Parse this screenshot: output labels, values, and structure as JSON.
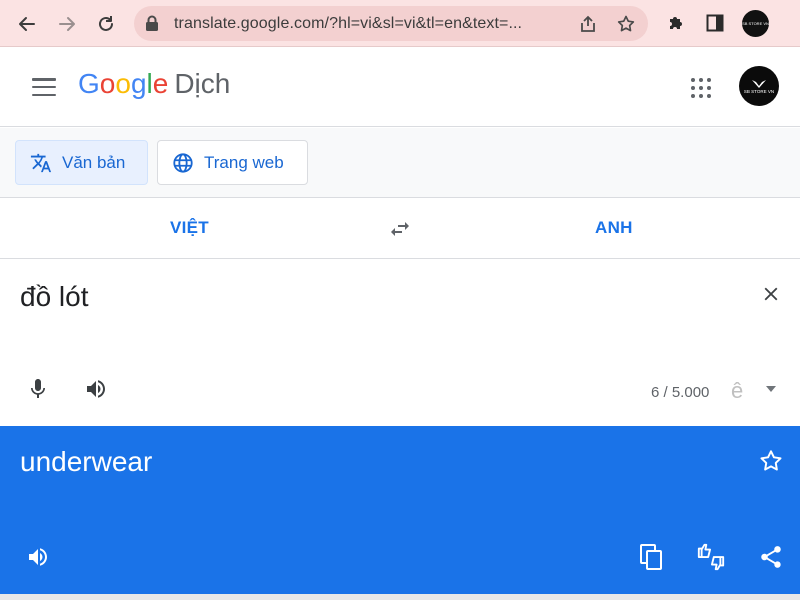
{
  "browser": {
    "url": "translate.google.com/?hl=vi&sl=vi&tl=en&text=...",
    "profile_text": "SB STORE VN"
  },
  "header": {
    "logo_letters": [
      "G",
      "o",
      "o",
      "g",
      "l",
      "e"
    ],
    "logo_colors": [
      "#4285f4",
      "#ea4335",
      "#fbbc05",
      "#4285f4",
      "#34a853",
      "#ea4335"
    ],
    "product_name": "Dịch",
    "avatar_text": "SB STORE VN"
  },
  "modes": {
    "text_label": "Văn bản",
    "web_label": "Trang web"
  },
  "languages": {
    "source": "VIỆT",
    "target": "ANH"
  },
  "source": {
    "text": "đồ lót",
    "char_count": "6 / 5.000",
    "ime_glyph": "ê"
  },
  "result": {
    "text": "underwear"
  },
  "colors": {
    "accent": "#1a73e8",
    "result_bg": "#1a73e8",
    "chrome_bg": "#fbe3e3"
  }
}
